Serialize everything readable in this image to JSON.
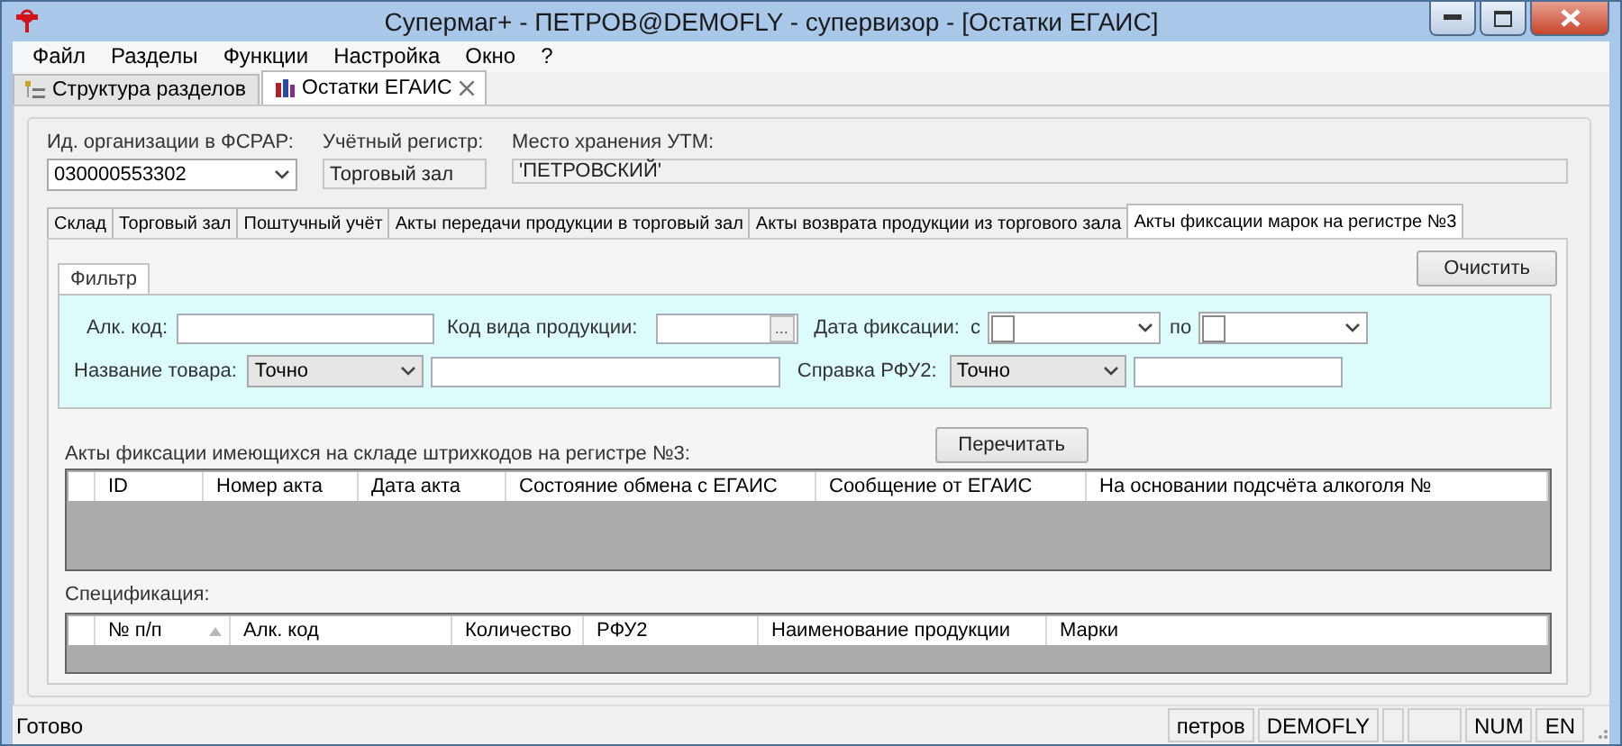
{
  "window": {
    "title": "Супермаг+ - ПЕТРОВ@DEMOFLY - супервизор  - [Остатки ЕГАИС]"
  },
  "menu": [
    {
      "label": "Файл"
    },
    {
      "label": "Разделы"
    },
    {
      "label": "Функции"
    },
    {
      "label": "Настройка"
    },
    {
      "label": "Окно"
    },
    {
      "label": "?"
    }
  ],
  "doc_tabs": [
    {
      "label": "Структура разделов",
      "selected": false,
      "closable": false
    },
    {
      "label": "Остатки ЕГАИС",
      "selected": true,
      "closable": true
    }
  ],
  "header_fields": [
    {
      "kind": "combo",
      "label": "Ид. организации в ФСРАР:",
      "value": "030000553302"
    },
    {
      "kind": "readonly",
      "label": "Учётный регистр:",
      "value": "Торговый зал"
    },
    {
      "kind": "readonly_wide",
      "label": "Место хранения УТМ:",
      "value": "'ПЕТРОВСКИЙ'"
    }
  ],
  "inner_tabs": [
    {
      "label": "Склад",
      "selected": false
    },
    {
      "label": "Торговый зал",
      "selected": false
    },
    {
      "label": "Поштучный учёт",
      "selected": false
    },
    {
      "label": "Акты передачи продукции в торговый зал",
      "selected": false
    },
    {
      "label": "Акты возврата продукции из торгового зала",
      "selected": false
    },
    {
      "label": "Акты фиксации марок на регистре №3",
      "selected": true
    }
  ],
  "filter": {
    "tab": "Фильтр",
    "clear_button": "Очистить",
    "alk_code": {
      "label": "Алк. код:"
    },
    "product_kind": {
      "label": "Код вида продукции:",
      "button": "..."
    },
    "date": {
      "label": "Дата фиксации:",
      "from_label": "с",
      "from_checked": false,
      "to_label": "по",
      "to_checked": false
    },
    "name": {
      "label": "Название товара:",
      "mode": "Точно"
    },
    "rfu2": {
      "label": "Справка РФУ2:",
      "mode": "Точно"
    }
  },
  "reread_button": "Перечитать",
  "acts_table": {
    "title": "Акты фиксации имеющихся на складе штрихкодов на регистре №3:",
    "columns": [
      {
        "label": "ID"
      },
      {
        "label": "Номер акта"
      },
      {
        "label": "Дата акта"
      },
      {
        "label": "Состояние обмена с ЕГАИС"
      },
      {
        "label": "Сообщение от ЕГАИС"
      },
      {
        "label": "На основании подсчёта алкоголя №"
      }
    ]
  },
  "spec_table": {
    "title": "Спецификация:",
    "columns": [
      {
        "label": "№ п/п",
        "sorted": true
      },
      {
        "label": "Алк. код"
      },
      {
        "label": "Количество"
      },
      {
        "label": "РФУ2"
      },
      {
        "label": "Наименование продукции"
      },
      {
        "label": "Марки"
      }
    ]
  },
  "status_bar": {
    "text": "Готово",
    "panels": [
      {
        "kind": "text",
        "text": "петров"
      },
      {
        "kind": "text",
        "text": "DEMOFLY"
      },
      {
        "kind": "empty"
      },
      {
        "kind": "empty"
      },
      {
        "kind": "text",
        "text": "NUM"
      },
      {
        "kind": "text",
        "text": "EN"
      }
    ]
  }
}
